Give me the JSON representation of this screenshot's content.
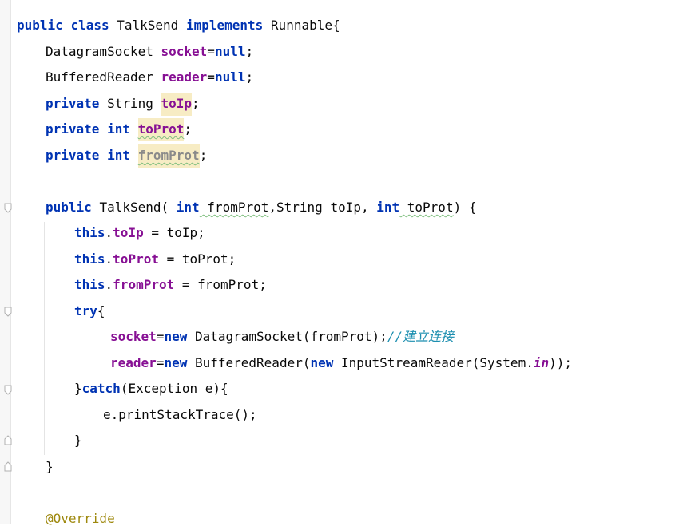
{
  "code": {
    "class_decl": {
      "kw_public": "public",
      "kw_class": "class",
      "class_name": "TalkSend",
      "kw_implements": "implements",
      "iface": "Runnable{"
    },
    "field1": {
      "type": "DatagramSocket",
      "name": "socket",
      "eq": "=",
      "val": "null",
      "semi": ";"
    },
    "field2": {
      "type": "BufferedReader",
      "name": "reader",
      "eq": "=",
      "val": "null",
      "semi": ";"
    },
    "field3": {
      "kw": "private",
      "type": "String",
      "name": "toIp",
      "semi": ";"
    },
    "field4": {
      "kw": "private",
      "type": "int",
      "name": "toProt",
      "semi": ";"
    },
    "field5": {
      "kw": "private",
      "type": "int",
      "name": "fromProt",
      "semi": ";"
    },
    "ctor": {
      "kw_public": "public",
      "sig_a": "TalkSend( ",
      "kw_int1": "int",
      "p1": " fromProt",
      "sig_b": ",String toIp, ",
      "kw_int2": "int",
      "p2": " toProt",
      "sig_c": ") {"
    },
    "assign1": {
      "this": "this",
      "dot": ".",
      "field": "toIp",
      "rest": " = toIp;"
    },
    "assign2": {
      "this": "this",
      "dot": ".",
      "field": "toProt",
      "rest": " = toProt;"
    },
    "assign3": {
      "this": "this",
      "dot": ".",
      "field": "fromProt",
      "rest": " = fromProt;"
    },
    "try": {
      "kw": "try",
      "brace": "{"
    },
    "stmt1": {
      "field": "socket",
      "eq": "=",
      "kw_new": "new",
      "rest": " DatagramSocket(fromProt);",
      "comment": "//建立连接"
    },
    "stmt2": {
      "field": "reader",
      "eq": "=",
      "kw_new": "new",
      "mid": " BufferedReader(",
      "kw_new2": "new",
      "mid2": " InputStreamReader(System.",
      "static_field": "in",
      "end": "));"
    },
    "catch": {
      "open": "}",
      "kw": "catch",
      "rest": "(Exception e){"
    },
    "stack": "e.printStackTrace();",
    "close_catch": "}",
    "close_ctor": "}",
    "annotation": "@Override"
  }
}
